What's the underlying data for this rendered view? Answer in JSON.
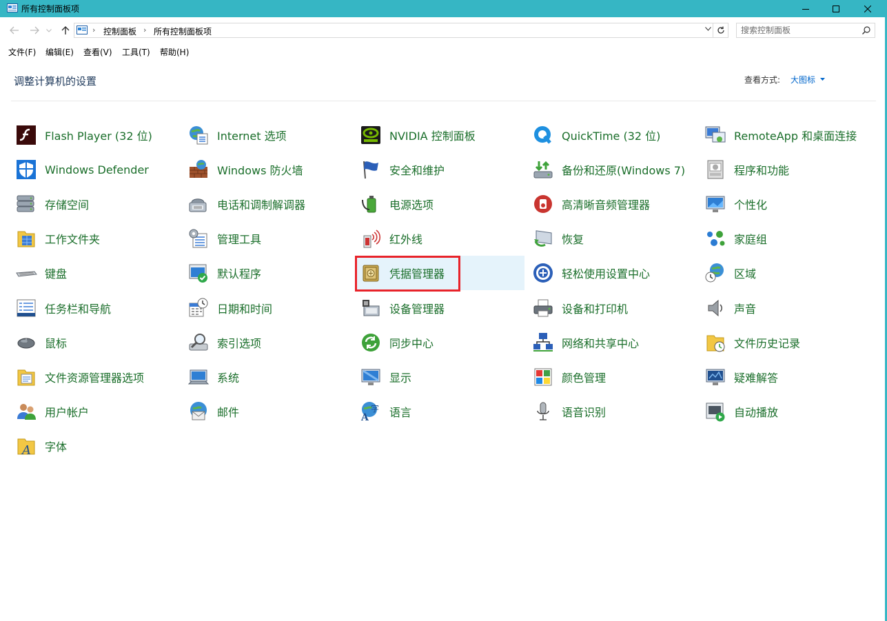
{
  "window": {
    "title": "所有控制面板项",
    "title_bar_color": "#36b6c4"
  },
  "address": {
    "crumbs": [
      "控制面板",
      "所有控制面板项"
    ],
    "search_placeholder": "搜索控制面板"
  },
  "menu": [
    "文件(F)",
    "编辑(E)",
    "查看(V)",
    "工具(T)",
    "帮助(H)"
  ],
  "header": {
    "title": "调整计算机的设置",
    "view_label": "查看方式:",
    "view_value": "大图标"
  },
  "link_color": "#1a6e2a",
  "highlight_color": "#e8232a",
  "items": [
    {
      "label": "Flash Player (32 位)",
      "icon": "flash-icon"
    },
    {
      "label": "Internet 选项",
      "icon": "internet-options-icon"
    },
    {
      "label": "NVIDIA 控制面板",
      "icon": "nvidia-icon"
    },
    {
      "label": "QuickTime (32 位)",
      "icon": "quicktime-icon"
    },
    {
      "label": "RemoteApp 和桌面连接",
      "icon": "remoteapp-icon"
    },
    {
      "label": "Windows Defender",
      "icon": "defender-shield-icon"
    },
    {
      "label": "Windows 防火墙",
      "icon": "firewall-icon"
    },
    {
      "label": "安全和维护",
      "icon": "flag-icon"
    },
    {
      "label": "备份和还原(Windows 7)",
      "icon": "backup-icon"
    },
    {
      "label": "程序和功能",
      "icon": "programs-icon"
    },
    {
      "label": "存储空间",
      "icon": "storage-icon"
    },
    {
      "label": "电话和调制解调器",
      "icon": "phone-modem-icon"
    },
    {
      "label": "电源选项",
      "icon": "power-icon"
    },
    {
      "label": "高清晰音频管理器",
      "icon": "audio-manager-icon"
    },
    {
      "label": "个性化",
      "icon": "personalization-icon"
    },
    {
      "label": "工作文件夹",
      "icon": "work-folders-icon"
    },
    {
      "label": "管理工具",
      "icon": "admin-tools-icon"
    },
    {
      "label": "红外线",
      "icon": "infrared-icon"
    },
    {
      "label": "恢复",
      "icon": "recovery-icon"
    },
    {
      "label": "家庭组",
      "icon": "homegroup-icon"
    },
    {
      "label": "键盘",
      "icon": "keyboard-icon"
    },
    {
      "label": "默认程序",
      "icon": "default-programs-icon"
    },
    {
      "label": "凭据管理器",
      "icon": "credential-vault-icon"
    },
    {
      "label": "轻松使用设置中心",
      "icon": "ease-of-access-icon"
    },
    {
      "label": "区域",
      "icon": "region-icon"
    },
    {
      "label": "任务栏和导航",
      "icon": "taskbar-icon"
    },
    {
      "label": "日期和时间",
      "icon": "date-time-icon"
    },
    {
      "label": "设备管理器",
      "icon": "device-manager-icon"
    },
    {
      "label": "设备和打印机",
      "icon": "printer-icon"
    },
    {
      "label": "声音",
      "icon": "speaker-icon"
    },
    {
      "label": "鼠标",
      "icon": "mouse-icon"
    },
    {
      "label": "索引选项",
      "icon": "indexing-icon"
    },
    {
      "label": "同步中心",
      "icon": "sync-icon"
    },
    {
      "label": "网络和共享中心",
      "icon": "network-icon"
    },
    {
      "label": "文件历史记录",
      "icon": "file-history-icon"
    },
    {
      "label": "文件资源管理器选项",
      "icon": "folder-options-icon"
    },
    {
      "label": "系统",
      "icon": "system-icon"
    },
    {
      "label": "显示",
      "icon": "display-icon"
    },
    {
      "label": "颜色管理",
      "icon": "color-management-icon"
    },
    {
      "label": "疑难解答",
      "icon": "troubleshooting-icon"
    },
    {
      "label": "用户帐户",
      "icon": "user-accounts-icon"
    },
    {
      "label": "邮件",
      "icon": "mail-icon"
    },
    {
      "label": "语言",
      "icon": "language-icon"
    },
    {
      "label": "语音识别",
      "icon": "microphone-icon"
    },
    {
      "label": "自动播放",
      "icon": "autoplay-icon"
    },
    {
      "label": "字体",
      "icon": "fonts-icon"
    }
  ]
}
